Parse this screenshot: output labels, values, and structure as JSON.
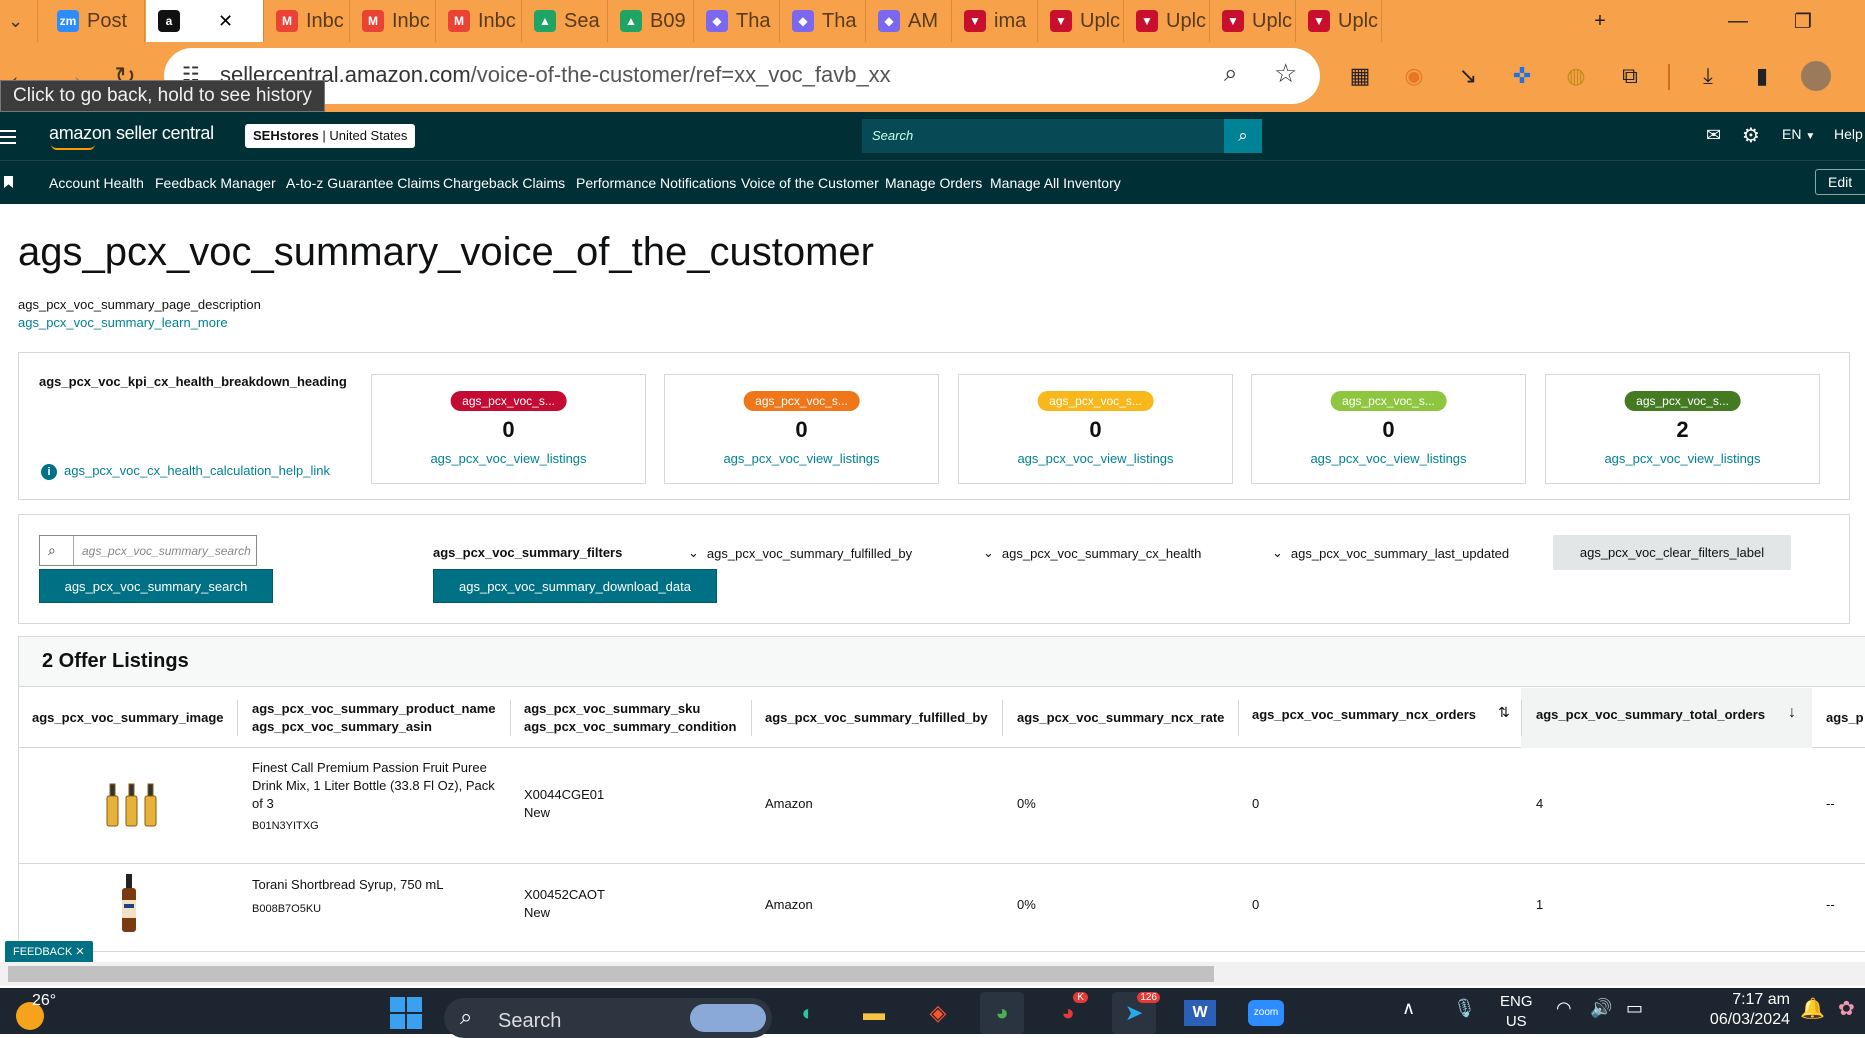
{
  "browser": {
    "tabs": [
      {
        "label": "Post",
        "icon": "zoom-icon",
        "color": "#2d8cff",
        "icon_text": "zm"
      },
      {
        "label": "",
        "icon": "amazon-icon",
        "color": "#111111",
        "icon_text": "a",
        "active": true
      },
      {
        "label": "Inbc",
        "icon": "gmail-icon",
        "color": "#ea4335",
        "icon_text": "M"
      },
      {
        "label": "Inbc",
        "icon": "gmail-icon",
        "color": "#ea4335",
        "icon_text": "M"
      },
      {
        "label": "Inbc",
        "icon": "gmail-icon",
        "color": "#ea4335",
        "icon_text": "M"
      },
      {
        "label": "Sea",
        "icon": "drive-icon",
        "color": "#1fa463",
        "icon_text": "▲"
      },
      {
        "label": "B09",
        "icon": "drive-icon",
        "color": "#1fa463",
        "icon_text": "▲"
      },
      {
        "label": "Tha",
        "icon": "clickup-icon",
        "color": "#7b68ee",
        "icon_text": "◆"
      },
      {
        "label": "Tha",
        "icon": "clickup-icon",
        "color": "#7b68ee",
        "icon_text": "◆"
      },
      {
        "label": "AM",
        "icon": "clickup-icon",
        "color": "#7b68ee",
        "icon_text": "◆"
      },
      {
        "label": "ima",
        "icon": "vendor-icon",
        "color": "#c8102e",
        "icon_text": "▼"
      },
      {
        "label": "Uplc",
        "icon": "vendor-icon",
        "color": "#c8102e",
        "icon_text": "▼"
      },
      {
        "label": "Uplc",
        "icon": "vendor-icon",
        "color": "#c8102e",
        "icon_text": "▼"
      },
      {
        "label": "Uplc",
        "icon": "vendor-icon",
        "color": "#c8102e",
        "icon_text": "▼"
      },
      {
        "label": "Uplc",
        "icon": "vendor-icon",
        "color": "#c8102e",
        "icon_text": "▼"
      }
    ],
    "close_tab_glyph": "✕",
    "new_tab_glyph": "+",
    "url_host": "sellercentral.amazon.com",
    "url_path": "/voice-of-the-customer/ref=xx_voc_favb_xx",
    "tooltip": "Click to go back, hold to see history"
  },
  "amazon": {
    "logo": "amazon seller central",
    "store": "SEHstores",
    "marketplace": "United States",
    "search_placeholder": "Search",
    "language": "EN",
    "help": "Help",
    "nav": [
      "Account Health",
      "Feedback Manager",
      "A-to-z Guarantee Claims",
      "Chargeback Claims",
      "Performance Notifications",
      "Voice of the Customer",
      "Manage Orders",
      "Manage All Inventory"
    ],
    "edit": "Edit"
  },
  "page": {
    "title": "ags_pcx_voc_summary_voice_of_the_customer",
    "description": "ags_pcx_voc_summary_page_description",
    "learn_more": "ags_pcx_voc_summary_learn_more",
    "kpi_heading": "ags_pcx_voc_kpi_cx_health_breakdown_heading",
    "help_link": "ags_pcx_voc_cx_health_calculation_help_link",
    "kpis": [
      {
        "pill": "ags_pcx_voc_s...",
        "value": "0",
        "link": "ags_pcx_voc_view_listings",
        "color": "#c40b34",
        "text_color": "#ffffff"
      },
      {
        "pill": "ags_pcx_voc_s...",
        "value": "0",
        "link": "ags_pcx_voc_view_listings",
        "color": "#f0761a",
        "text_color": "#ffffff"
      },
      {
        "pill": "ags_pcx_voc_s...",
        "value": "0",
        "link": "ags_pcx_voc_view_listings",
        "color": "#f8b81c",
        "text_color": "#ffffff"
      },
      {
        "pill": "ags_pcx_voc_s...",
        "value": "0",
        "link": "ags_pcx_voc_view_listings",
        "color": "#8ec63f",
        "text_color": "#ffffff"
      },
      {
        "pill": "ags_pcx_voc_s...",
        "value": "2",
        "link": "ags_pcx_voc_view_listings",
        "color": "#437a22",
        "text_color": "#ffffff"
      }
    ],
    "filters": {
      "search_placeholder": "ags_pcx_voc_summary_search",
      "search_button": "ags_pcx_voc_summary_search",
      "filters_label": "ags_pcx_voc_summary_filters",
      "download": "ags_pcx_voc_summary_download_data",
      "fulfilled_by": "ags_pcx_voc_summary_fulfilled_by",
      "cx_health": "ags_pcx_voc_summary_cx_health",
      "last_updated": "ags_pcx_voc_summary_last_updated",
      "clear": "ags_pcx_voc_clear_filters_label"
    },
    "table": {
      "heading": "2 Offer Listings",
      "columns": {
        "image": "ags_pcx_voc_summary_image",
        "product_name": "ags_pcx_voc_summary_product_name",
        "asin": "ags_pcx_voc_summary_asin",
        "sku": "ags_pcx_voc_summary_sku",
        "condition": "ags_pcx_voc_summary_condition",
        "fulfilled_by": "ags_pcx_voc_summary_fulfilled_by",
        "ncx_rate": "ags_pcx_voc_summary_ncx_rate",
        "ncx_orders": "ags_pcx_voc_summary_ncx_orders",
        "total_orders": "ags_pcx_voc_summary_total_orders",
        "more": "ags_p"
      },
      "rows": [
        {
          "name": "Finest Call Premium Passion Fruit Puree Drink Mix, 1 Liter Bottle (33.8 Fl Oz), Pack of 3",
          "asin": "B01N3YITXG",
          "sku": "X0044CGE01",
          "condition": "New",
          "fulfilled_by": "Amazon",
          "ncx_rate": "0%",
          "ncx_orders": "0",
          "total_orders": "4",
          "more": "--"
        },
        {
          "name": "Torani Shortbread Syrup, 750 mL",
          "asin": "B008B7O5KU",
          "sku": "X00452CAOT",
          "condition": "New",
          "fulfilled_by": "Amazon",
          "ncx_rate": "0%",
          "ncx_orders": "0",
          "total_orders": "1",
          "more": "--"
        }
      ]
    },
    "feedback": "FEEDBACK"
  },
  "taskbar": {
    "weather": "26°",
    "search": "Search",
    "lang": "ENG",
    "region": "US",
    "time": "7:17 am",
    "date": "06/03/2024",
    "badge_k": "K",
    "badge_126": "126",
    "zoom_label": "zoom"
  }
}
